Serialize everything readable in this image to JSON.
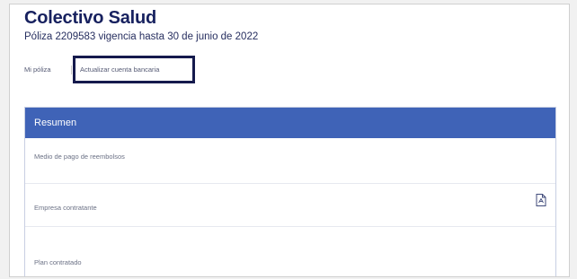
{
  "header": {
    "title": "Colectivo Salud",
    "subtitle": "Póliza 2209583 vigencia hasta 30 de junio de 2022"
  },
  "nav": {
    "items": [
      {
        "label": "Mi póliza"
      },
      {
        "label": "Actualizar cuenta bancaria"
      }
    ]
  },
  "summary": {
    "header_label": "Resumen",
    "rows": [
      {
        "label": "Medio de pago de reembolsos"
      },
      {
        "label": "Empresa contratante"
      },
      {
        "label": "Plan contratado"
      }
    ],
    "document_icon": "document-icon"
  },
  "colors": {
    "title": "#17215f",
    "card_header": "#3f63b7",
    "highlight_box": "#151a4d"
  }
}
